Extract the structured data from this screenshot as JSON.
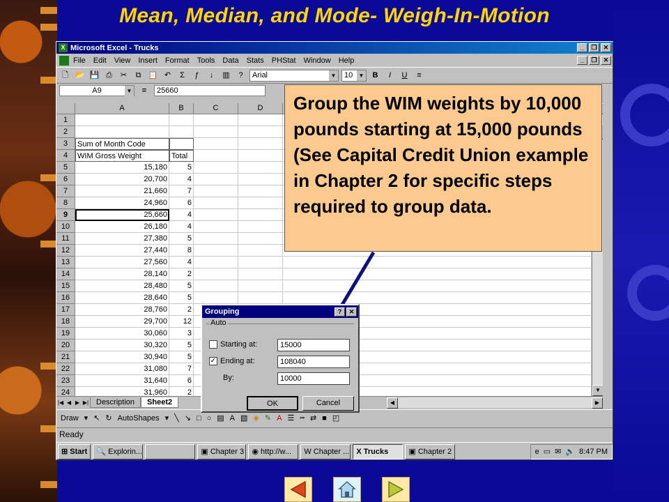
{
  "slide": {
    "title": "Mean, Median, and Mode- Weigh-In-Motion"
  },
  "excel": {
    "title": "Microsoft Excel - Trucks",
    "menus": [
      "File",
      "Edit",
      "View",
      "Insert",
      "Format",
      "Tools",
      "Data",
      "Stats",
      "PHStat",
      "Window",
      "Help"
    ],
    "font_name": "Arial",
    "font_size": "10",
    "name_box": "A9",
    "formula": "25660",
    "columns": [
      "A",
      "B",
      "C",
      "D"
    ],
    "rows": [
      {
        "n": "1",
        "a": "",
        "b": ""
      },
      {
        "n": "2",
        "a": "",
        "b": ""
      },
      {
        "n": "3",
        "a": "Sum of Month Code",
        "b": ""
      },
      {
        "n": "4",
        "a": "WIM Gross Weight",
        "b": "Total"
      },
      {
        "n": "5",
        "a": "15,180",
        "b": "5"
      },
      {
        "n": "6",
        "a": "20,700",
        "b": "4"
      },
      {
        "n": "7",
        "a": "21,660",
        "b": "7"
      },
      {
        "n": "8",
        "a": "24,960",
        "b": "6"
      },
      {
        "n": "9",
        "a": "25,660",
        "b": "4"
      },
      {
        "n": "10",
        "a": "26,180",
        "b": "4"
      },
      {
        "n": "11",
        "a": "27,380",
        "b": "5"
      },
      {
        "n": "12",
        "a": "27,440",
        "b": "8"
      },
      {
        "n": "13",
        "a": "27,560",
        "b": "4"
      },
      {
        "n": "14",
        "a": "28,140",
        "b": "2"
      },
      {
        "n": "15",
        "a": "28,480",
        "b": "5"
      },
      {
        "n": "16",
        "a": "28,640",
        "b": "5"
      },
      {
        "n": "17",
        "a": "28,760",
        "b": "2"
      },
      {
        "n": "18",
        "a": "29,700",
        "b": "12"
      },
      {
        "n": "19",
        "a": "30,060",
        "b": "3"
      },
      {
        "n": "20",
        "a": "30,320",
        "b": "5"
      },
      {
        "n": "21",
        "a": "30,940",
        "b": "5"
      },
      {
        "n": "22",
        "a": "31,080",
        "b": "7"
      },
      {
        "n": "23",
        "a": "31,640",
        "b": "6"
      },
      {
        "n": "24",
        "a": "31,960",
        "b": "2"
      }
    ],
    "sheet_tabs": [
      "Description",
      "Sheet2"
    ],
    "draw_label": "Draw",
    "autoshapes_label": "AutoShapes",
    "status": "Ready"
  },
  "callout": {
    "text": "Group the WIM weights by 10,000 pounds starting at 15,000 pounds (See Capital Credit Union example in Chapter 2 for specific steps required to group data."
  },
  "dialog": {
    "title": "Grouping",
    "group_label": "Auto",
    "starting_label": "Starting at:",
    "starting_checked": false,
    "starting_value": "15000",
    "ending_label": "Ending at:",
    "ending_checked": true,
    "ending_value": "108040",
    "by_label": "By:",
    "by_value": "10000",
    "ok_label": "OK",
    "cancel_label": "Cancel"
  },
  "taskbar": {
    "start": "Start",
    "tasks": [
      "Explorin...",
      "",
      "Chapter 3",
      "http://w...",
      "Chapter ...",
      "Trucks",
      "Chapter 2"
    ],
    "active_task": "Trucks",
    "clock": "8:47 PM"
  },
  "colors": {
    "background": "#0a0a96",
    "title": "#ffd600",
    "callout": "#fcc98f",
    "arrow": "#10107a"
  }
}
